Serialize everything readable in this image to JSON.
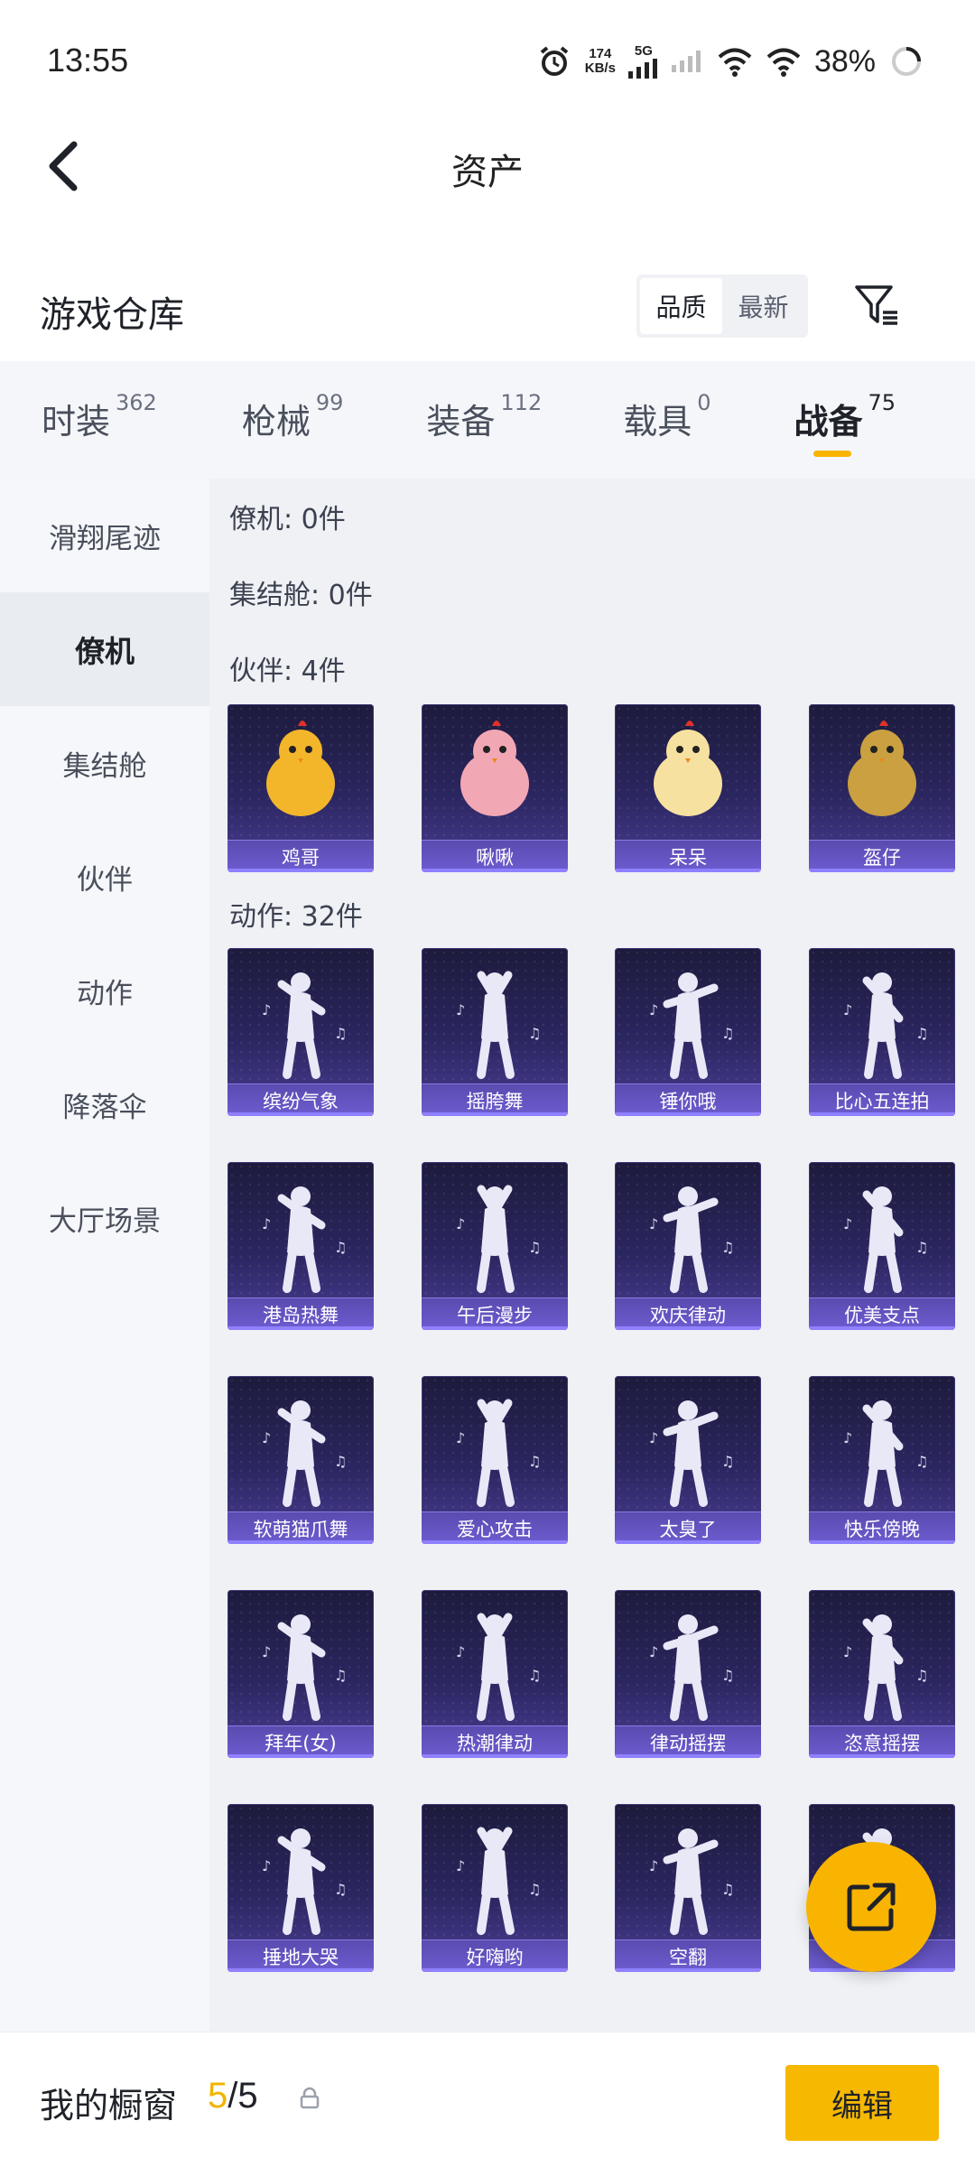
{
  "status": {
    "time": "13:55",
    "net_speed_value": "174",
    "net_speed_unit": "KB/s",
    "network": "5G",
    "battery": "38%"
  },
  "header": {
    "title": "资产"
  },
  "section": {
    "title": "游戏仓库",
    "sort_options": [
      "品质",
      "最新"
    ],
    "active_sort": "品质"
  },
  "tabs": [
    {
      "label": "时装",
      "count": "362"
    },
    {
      "label": "枪械",
      "count": "99"
    },
    {
      "label": "装备",
      "count": "112"
    },
    {
      "label": "载具",
      "count": "0"
    },
    {
      "label": "战备",
      "count": "75",
      "active": true
    }
  ],
  "sidebar": {
    "items": [
      "滑翔尾迹",
      "僚机",
      "集结舱",
      "伙伴",
      "动作",
      "降落伞",
      "大厅场景"
    ],
    "active": "僚机"
  },
  "groups": {
    "wingman": "僚机: 0件",
    "capsule": "集结舱: 0件",
    "partner": "伙伴: 4件",
    "emote": "动作: 32件"
  },
  "partners": [
    "鸡哥",
    "啾啾",
    "呆呆",
    "盔仔"
  ],
  "emotes": [
    "缤纷气象",
    "摇胯舞",
    "锤你哦",
    "比心五连拍",
    "港岛热舞",
    "午后漫步",
    "欢庆律动",
    "优美支点",
    "软萌猫爪舞",
    "爱心攻击",
    "太臭了",
    "快乐傍晚",
    "拜年(女)",
    "热潮律动",
    "律动摇摆",
    "恣意摇摆",
    "捶地大哭",
    "好嗨哟",
    "空翻",
    ""
  ],
  "bottom": {
    "window_label": "我的橱窗",
    "current": "5",
    "separator": "/",
    "max": "5",
    "edit_label": "编辑"
  },
  "colors": {
    "accent": "#f6b800",
    "card_top": "#1c1b3c",
    "card_bottom": "#4a3e96",
    "label_bar": "#6d5cd0"
  }
}
